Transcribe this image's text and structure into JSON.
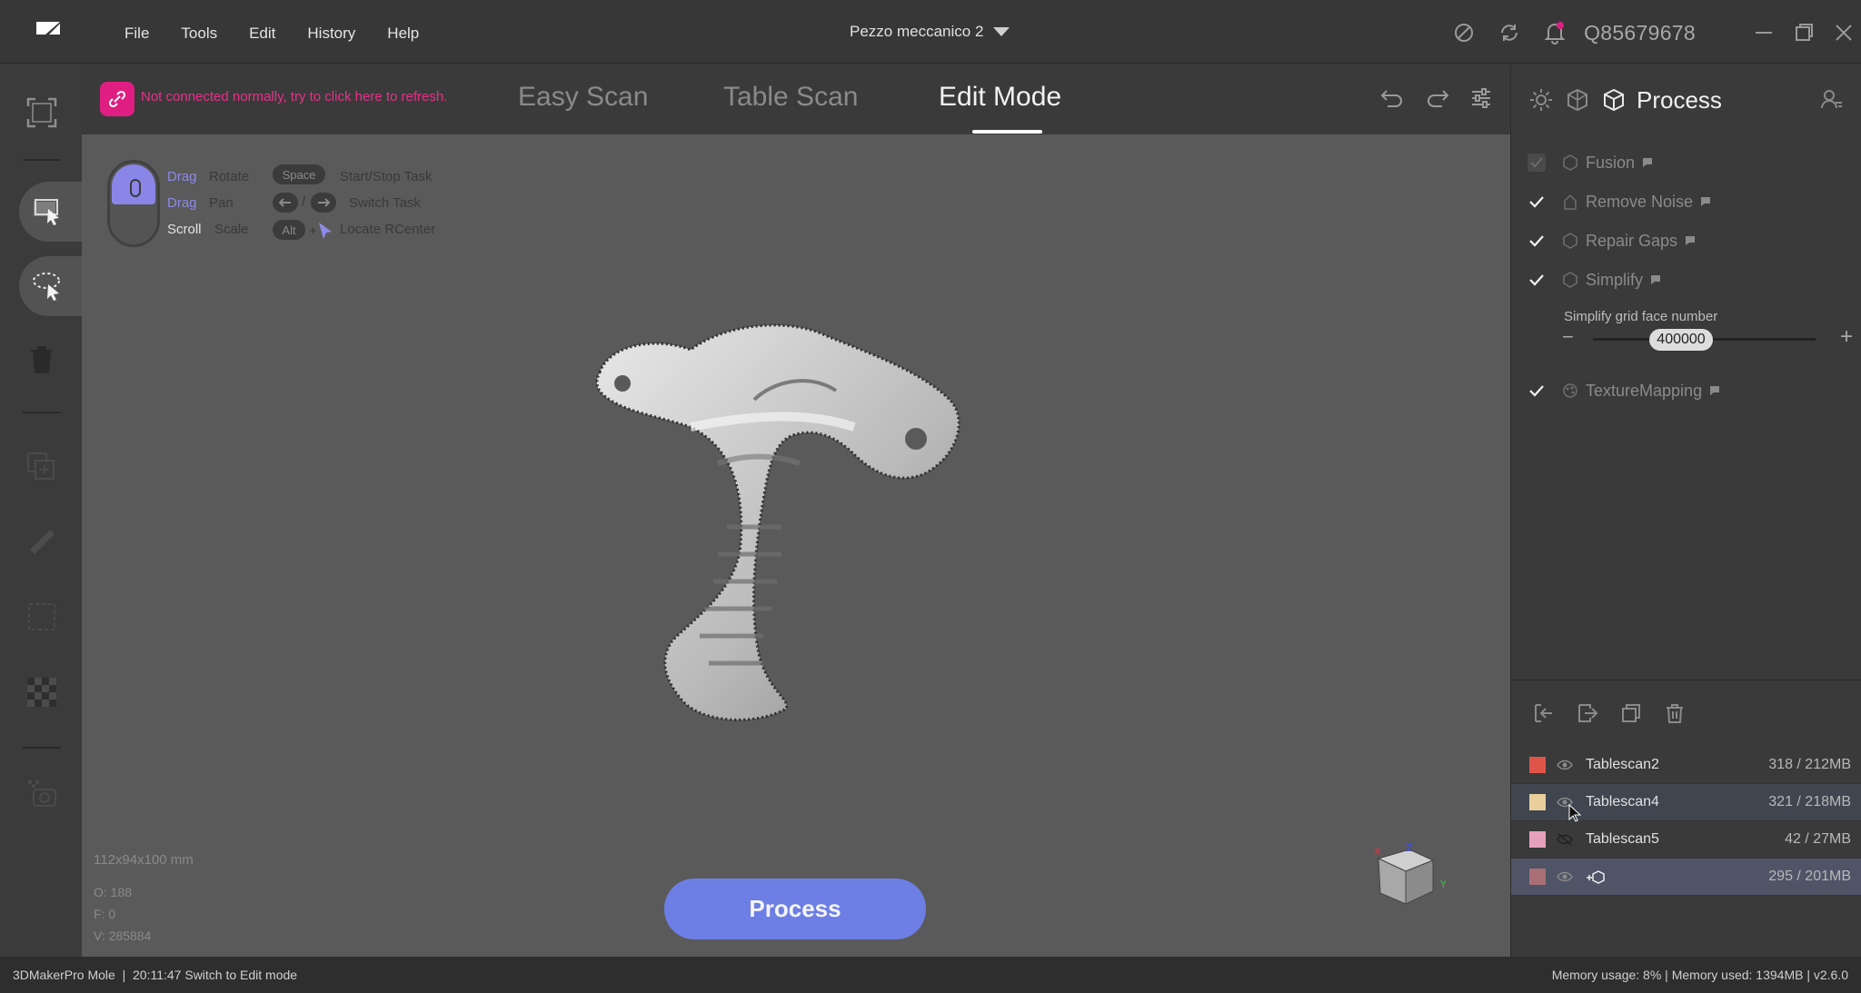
{
  "app": {
    "name": "3DMakerPro Mole",
    "project_name": "Pezzo meccanico 2",
    "user_id": "Q85679678"
  },
  "menu": [
    "File",
    "Tools",
    "Edit",
    "History",
    "Help"
  ],
  "connection_warning": "Not connected normally, try to click here to refresh.",
  "tabs": [
    {
      "label": "Easy Scan",
      "active": false
    },
    {
      "label": "Table Scan",
      "active": false
    },
    {
      "label": "Edit Mode",
      "active": true
    }
  ],
  "hints": {
    "drag": "Drag",
    "rotate": "Rotate",
    "pan": "Pan",
    "scroll": "Scroll",
    "scale": "Scale",
    "space_key": "Space",
    "start_stop": "Start/Stop Task",
    "switch_task": "Switch Task",
    "alt_key": "Alt",
    "locate": "Locate RCenter"
  },
  "viewport": {
    "dimensions": "112x94x100 mm",
    "stat_o": "O: 188",
    "stat_f": "F: 0",
    "stat_v": "V: 285884"
  },
  "process_button": "Process",
  "right_panel": {
    "title": "Process",
    "items": [
      {
        "label": "Fusion",
        "checked": true,
        "enabled": false
      },
      {
        "label": "Remove Noise",
        "checked": true,
        "enabled": true
      },
      {
        "label": "Repair Gaps",
        "checked": true,
        "enabled": true
      },
      {
        "label": "Simplify",
        "checked": true,
        "enabled": true
      },
      {
        "label": "TextureMapping",
        "checked": true,
        "enabled": true
      }
    ],
    "simplify_label": "Simplify grid face number",
    "simplify_value": "400000"
  },
  "scans": [
    {
      "name": "Tablescan2",
      "size": "318 / 212MB",
      "color": "#e0554a",
      "visible": true
    },
    {
      "name": "Tablescan4",
      "size": "321 / 218MB",
      "color": "#e8cf9c",
      "visible": true
    },
    {
      "name": "Tablescan5",
      "size": "42 / 27MB",
      "color": "#e8a1bd",
      "visible": false
    },
    {
      "name": "",
      "size": "295 / 201MB",
      "color": "#a87074",
      "visible": true
    }
  ],
  "status": {
    "left": "3DMakerPro Mole  |  20:11:47 Switch to Edit mode",
    "right": "Memory usage: 8% | Memory used: 1394MB | v2.6.0"
  },
  "colors": {
    "accent": "#6d7fe5",
    "warning": "#e01e82",
    "titlebar": "#373737",
    "viewport": "#5a5a5a"
  }
}
